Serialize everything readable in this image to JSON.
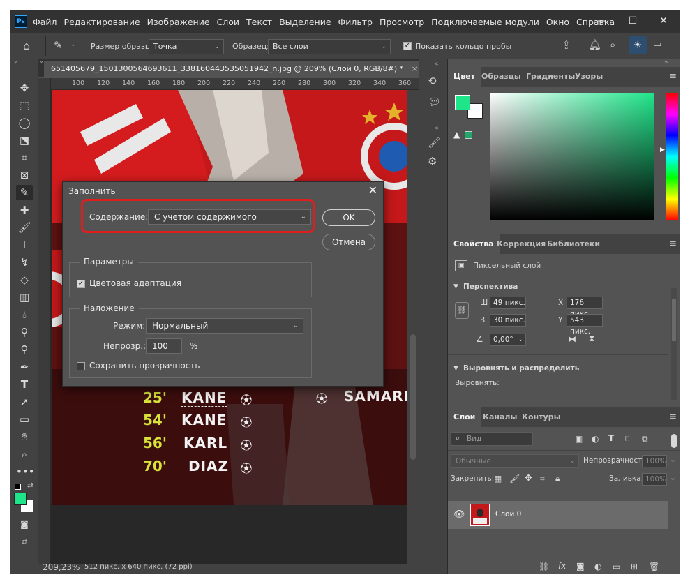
{
  "menu": {
    "items": [
      "Файл",
      "Редактирование",
      "Изображение",
      "Слои",
      "Текст",
      "Выделение",
      "Фильтр",
      "Просмотр",
      "Подключаемые модули",
      "Окно",
      "Справка"
    ]
  },
  "options_bar": {
    "sample_size_label": "Размер образца:",
    "sample_size_value": "Точка",
    "sample_label": "Образец:",
    "sample_value": "Все слои",
    "show_ring_label": "Показать кольцо пробы"
  },
  "document": {
    "tab_title": "651405679_1501300564693611_338160443535051942_n.jpg @ 209% (Слой 0, RGB/8#) *",
    "zoom": "209,23%",
    "doc_info": "512 пикс. x 640 пикс. (72 ppi)",
    "ruler_ticks": [
      "100",
      "120",
      "140",
      "160",
      "180",
      "200",
      "220",
      "240",
      "260",
      "280",
      "300",
      "320",
      "340",
      "360"
    ]
  },
  "scoreboard": [
    {
      "minute": "25'",
      "name": "KANE"
    },
    {
      "minute": "54'",
      "name": "KANE"
    },
    {
      "minute": "56'",
      "name": "KARL"
    },
    {
      "minute": "70'",
      "name": "DIAZ"
    }
  ],
  "scoreboard_right": "SAMARD",
  "fill_dialog": {
    "title": "Заполнить",
    "contents_label": "Содержание:",
    "contents_value": "С учетом содержимого",
    "ok_label": "OK",
    "cancel_label": "Отмена",
    "options_group": "Параметры",
    "color_adapt_label": "Цветовая адаптация",
    "blending_group": "Наложение",
    "mode_label": "Режим:",
    "mode_value": "Нормальный",
    "opacity_label": "Непрозр.:",
    "opacity_value": "100",
    "opacity_unit": "%",
    "preserve_label": "Сохранить прозрачность"
  },
  "color_panel": {
    "tabs": [
      "Цвет",
      "Образцы",
      "Градиенты",
      "Узоры"
    ],
    "fg_color": "#1fe58a",
    "bg_color": "#ffffff"
  },
  "properties_panel": {
    "tabs": [
      "Свойства",
      "Коррекция",
      "Библиотеки"
    ],
    "layer_type": "Пиксельный слой",
    "perspective_header": "Перспектива",
    "w_label": "Ш",
    "w_value": "49 пикс.",
    "h_label": "В",
    "h_value": "30 пикс.",
    "x_label": "X",
    "x_value": "176 пикс.",
    "y_label": "Y",
    "y_value": "543 пикс.",
    "angle_value": "0,00°",
    "align_header": "Выровнять и распределить",
    "align_label": "Выровнять:"
  },
  "layers_panel": {
    "tabs": [
      "Слои",
      "Каналы",
      "Контуры"
    ],
    "search_placeholder": "Вид",
    "blend_mode": "Обычные",
    "opacity_label": "Непрозрачность:",
    "opacity_value": "100%",
    "lock_label": "Закрепить:",
    "fill_label": "Заливка:",
    "fill_value": "100%",
    "layers": [
      {
        "name": "Слой 0"
      }
    ]
  }
}
